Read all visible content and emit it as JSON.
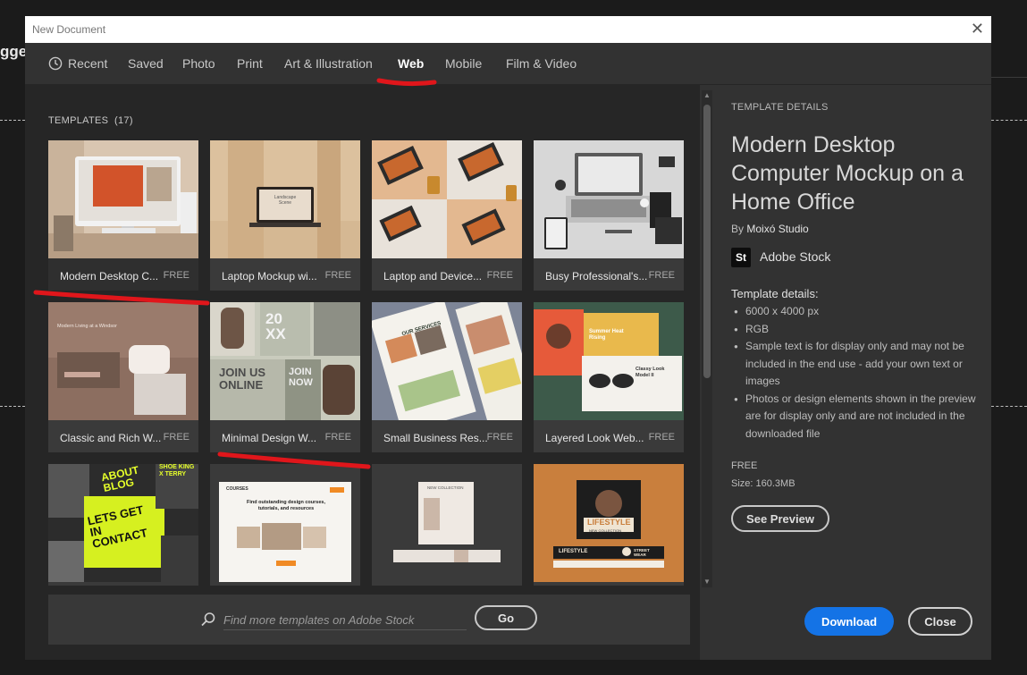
{
  "background": {
    "title_fragment": "gge"
  },
  "dialog": {
    "title": "New Document",
    "close_glyph": "✕"
  },
  "tabs": [
    {
      "label": "Recent",
      "icon": "clock-icon",
      "active": false
    },
    {
      "label": "Saved",
      "active": false
    },
    {
      "label": "Photo",
      "active": false
    },
    {
      "label": "Print",
      "active": false
    },
    {
      "label": "Art & Illustration",
      "active": false
    },
    {
      "label": "Web",
      "active": true
    },
    {
      "label": "Mobile",
      "active": false
    },
    {
      "label": "Film & Video",
      "active": false
    }
  ],
  "templates": {
    "label": "TEMPLATES",
    "count": "(17)",
    "items": [
      {
        "name": "Modern Desktop C...",
        "badge": "FREE",
        "selected": true
      },
      {
        "name": "Laptop Mockup wi...",
        "badge": "FREE"
      },
      {
        "name": "Laptop and Device...",
        "badge": "FREE"
      },
      {
        "name": "Busy Professional's...",
        "badge": "FREE"
      },
      {
        "name": "Classic and Rich W...",
        "badge": "FREE"
      },
      {
        "name": "Minimal Design W...",
        "badge": "FREE"
      },
      {
        "name": "Small Business Res...",
        "badge": "FREE"
      },
      {
        "name": "Layered Look Web...",
        "badge": "FREE"
      },
      {
        "name": "",
        "badge": ""
      },
      {
        "name": "",
        "badge": ""
      },
      {
        "name": "",
        "badge": ""
      },
      {
        "name": "",
        "badge": ""
      }
    ],
    "thumb_text": {
      "t2": "Landscape Scene",
      "t5": "Modern Living at a Windsor",
      "t6_big": "20 XX",
      "t6_join1": "JOIN US ONLINE",
      "t6_join2": "JOIN NOW",
      "t7": "OUR SERVICES",
      "t8a": "Summer Heat Rising",
      "t8b": "Classy Look Model II",
      "t9a": "ABOUT BLOG",
      "t9b": "LETS GET IN CONTACT",
      "t9c": "SHOE KING X TERRY",
      "t10a": "COURSES",
      "t10b": "Find outstanding design courses, tutorials, and resources",
      "t11": "NEW COLLECTION",
      "t12a": "LIFESTYLE",
      "t12b": "NEW COLLECTION",
      "t12c": "STREET WEAR"
    }
  },
  "search": {
    "placeholder": "Find more templates on Adobe Stock",
    "go_label": "Go"
  },
  "details": {
    "section_label": "TEMPLATE DETAILS",
    "title": "Modern Desktop Computer Mockup on a Home Office",
    "by_prefix": "By",
    "author": "Moixó Studio",
    "stock_icon": "St",
    "stock_label": "Adobe Stock",
    "subhead": "Template details:",
    "bullets": [
      "6000 x 4000 px",
      "RGB",
      "Sample text is for display only and may not be included in the end use - add your own text or images",
      "Photos or design elements shown in the preview are for display only and are not included in the downloaded file"
    ],
    "price": "FREE",
    "size": "Size:  160.3MB",
    "preview_label": "See Preview",
    "download_label": "Download",
    "close_label": "Close"
  },
  "colors": {
    "accent": "#1473e6",
    "selection": "#2c8ff0",
    "annotation": "#e0161b"
  }
}
